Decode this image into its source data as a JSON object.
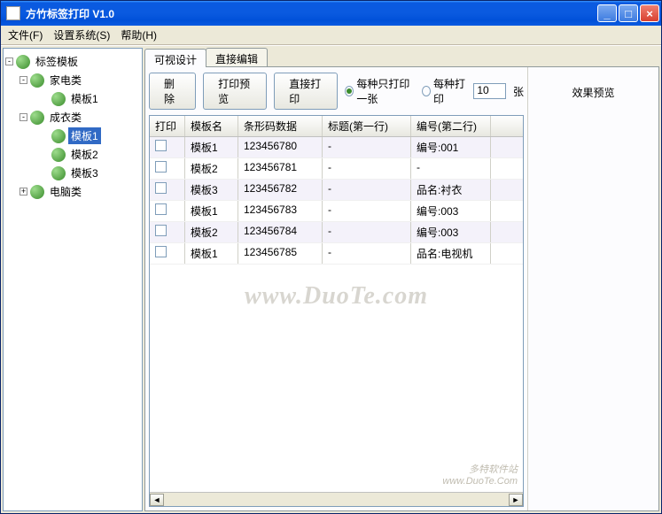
{
  "title": "方竹标签打印  V1.0",
  "menu": {
    "file": "文件(F)",
    "settings": "设置系统(S)",
    "help": "帮助(H)"
  },
  "tree": {
    "root": "标签模板",
    "cat1": "家电类",
    "cat1_items": [
      "模板1"
    ],
    "cat2": "成衣类",
    "cat2_items": [
      "模板1",
      "模板2",
      "模板3"
    ],
    "cat2_selected": 0,
    "cat3": "电脑类"
  },
  "tabs": {
    "visual": "可视设计",
    "direct": "直接编辑"
  },
  "toolbar": {
    "delete": "删除",
    "preview": "打印预览",
    "print": "直接打印",
    "radio_one": "每种只打印一张",
    "radio_each": "每种打印",
    "copies": "10",
    "sheets": "张"
  },
  "grid": {
    "cols": [
      "打印",
      "模板名",
      "条形码数据",
      "标题(第一行)",
      "编号(第二行)"
    ],
    "rows": [
      {
        "tpl": "模板1",
        "barcode": "123456780",
        "title": "-",
        "serial": "编号:001"
      },
      {
        "tpl": "模板2",
        "barcode": "123456781",
        "title": "-",
        "serial": "-"
      },
      {
        "tpl": "模板3",
        "barcode": "123456782",
        "title": "-",
        "serial": "品名:衬衣"
      },
      {
        "tpl": "模板1",
        "barcode": "123456783",
        "title": "-",
        "serial": "编号:003"
      },
      {
        "tpl": "模板2",
        "barcode": "123456784",
        "title": "-",
        "serial": "编号:003"
      },
      {
        "tpl": "模板1",
        "barcode": "123456785",
        "title": "-",
        "serial": "品名:电视机"
      }
    ]
  },
  "preview_label": "效果预览",
  "watermark": "www.DuoTe.com",
  "corner": "多特软件站\nwww.DuoTe.Com"
}
